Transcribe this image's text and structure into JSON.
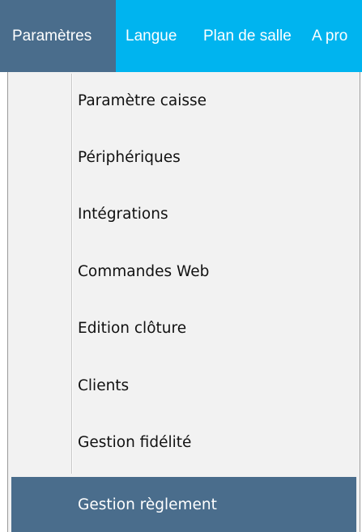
{
  "menubar": {
    "items": [
      {
        "label": "Paramètres",
        "state": "open"
      },
      {
        "label": "Langue"
      },
      {
        "label": "Plan de salle"
      },
      {
        "label": "A pro"
      }
    ]
  },
  "dropdown": {
    "items": [
      {
        "label": "Paramètre caisse"
      },
      {
        "label": "Périphériques"
      },
      {
        "label": "Intégrations"
      },
      {
        "label": "Commandes Web"
      },
      {
        "label": "Edition clôture"
      },
      {
        "label": "Clients"
      },
      {
        "label": "Gestion fidélité"
      },
      {
        "label": "Gestion règlement",
        "state": "highlighted"
      }
    ]
  },
  "colors": {
    "menubar_bg": "#00b4ef",
    "highlight_bg": "#4a6d8c",
    "dropdown_bg": "#f2f2f2"
  }
}
